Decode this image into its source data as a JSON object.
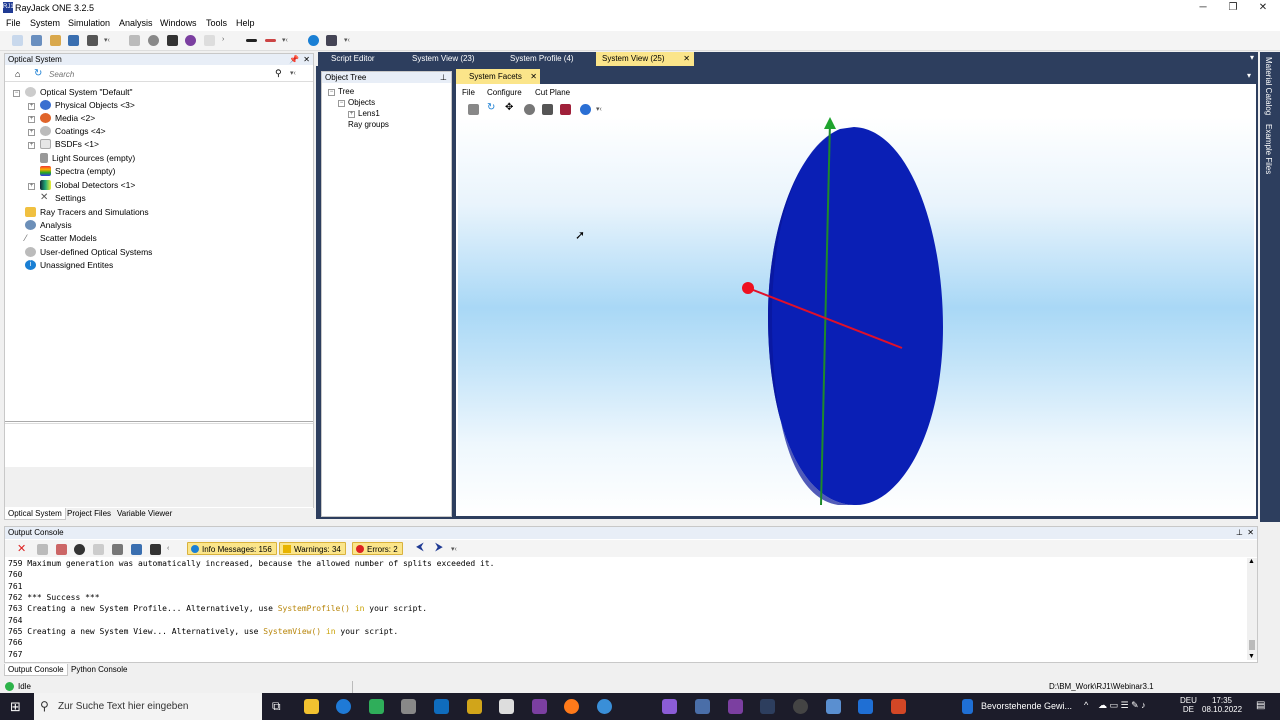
{
  "window": {
    "title": "RayJack ONE 3.2.5",
    "icon_text": "RJ1"
  },
  "menu": [
    "File",
    "System",
    "Simulation",
    "Analysis",
    "Windows",
    "Tools",
    "Help"
  ],
  "optical_panel": {
    "title": "Optical System",
    "search_placeholder": "Search",
    "tree": [
      {
        "label": "Optical System \"Default\"",
        "level": 0,
        "icon": "system-icon"
      },
      {
        "label": "Physical Objects <3>",
        "level": 1,
        "icon": "objects-icon"
      },
      {
        "label": "Media <2>",
        "level": 1,
        "icon": "media-icon"
      },
      {
        "label": "Coatings <4>",
        "level": 1,
        "icon": "coatings-icon"
      },
      {
        "label": "BSDFs <1>",
        "level": 1,
        "icon": "bsdf-icon"
      },
      {
        "label": "Light Sources (empty)",
        "level": 1,
        "icon": "light-source-icon"
      },
      {
        "label": "Spectra (empty)",
        "level": 1,
        "icon": "spectra-icon"
      },
      {
        "label": "Global Detectors <1>",
        "level": 1,
        "icon": "detector-icon"
      },
      {
        "label": "Settings",
        "level": 1,
        "icon": "settings-icon"
      },
      {
        "label": "Ray Tracers and Simulations",
        "level": 0,
        "icon": "raytracer-icon"
      },
      {
        "label": "Analysis",
        "level": 0,
        "icon": "analysis-icon"
      },
      {
        "label": "Scatter Models",
        "level": 0,
        "icon": "scatter-icon"
      },
      {
        "label": "User-defined Optical Systems",
        "level": 0,
        "icon": "user-system-icon"
      },
      {
        "label": "Unassigned Entites",
        "level": 0,
        "icon": "info-icon"
      }
    ],
    "bottom_tabs": [
      "Optical System",
      "Project Files",
      "Variable Viewer"
    ]
  },
  "doc_tabs": [
    "Script Editor",
    "System View (23)",
    "System Profile (4)",
    "System View (25)"
  ],
  "object_tree": {
    "title": "Object Tree",
    "items": [
      "Tree",
      "Objects",
      "Lens1",
      "Ray groups"
    ]
  },
  "facets": {
    "tab": "System Facets",
    "menu": [
      "File",
      "Configure",
      "Cut Plane"
    ]
  },
  "right_tabs": [
    "Material Catalog",
    "Example Files"
  ],
  "console": {
    "title": "Output Console",
    "info": "Info Messages: 156",
    "warnings": "Warnings: 34",
    "errors": "Errors: 2",
    "lines": [
      {
        "n": "759",
        "text": "Maximum generation was automatically increased, because the allowed number of splits exceeded it."
      },
      {
        "n": "760",
        "text": ""
      },
      {
        "n": "761",
        "text": ""
      },
      {
        "n": "762",
        "text": "*** Success ***"
      },
      {
        "n": "763",
        "pre": "Creating a new System Profile... Alternatively, use ",
        "fn": "SystemProfile()",
        "kw": "in",
        "post": " your script."
      },
      {
        "n": "764",
        "text": ""
      },
      {
        "n": "765",
        "pre": "Creating a new System View... Alternatively, use ",
        "fn": "SystemView()",
        "kw": "in",
        "post": " your script."
      },
      {
        "n": "766",
        "text": ""
      },
      {
        "n": "767",
        "text": ""
      }
    ],
    "tabs": [
      "Output Console",
      "Python Console"
    ]
  },
  "status": {
    "state": "Idle",
    "path": "D:\\BM_Work\\RJ1\\Webinar3.1"
  },
  "taskbar": {
    "search_placeholder": "Zur Suche Text hier eingeben",
    "news": "Bevorstehende Gewi...",
    "lang_top": "DEU",
    "lang_bottom": "DE",
    "time": "17:35",
    "date": "08.10.2022"
  }
}
